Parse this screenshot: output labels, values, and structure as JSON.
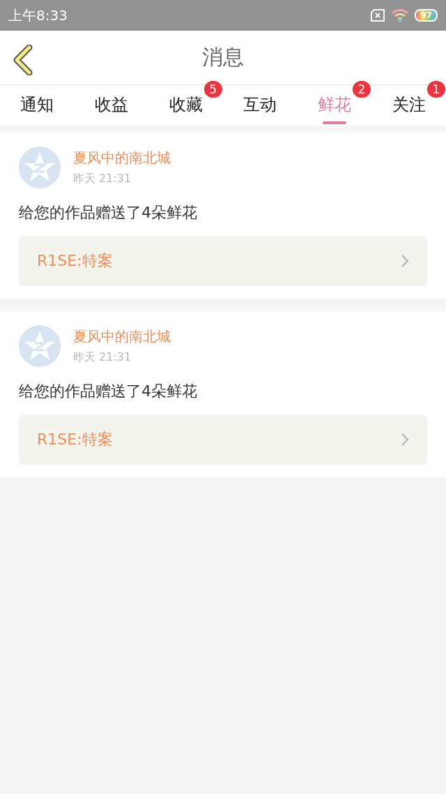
{
  "status_bar": {
    "time": "上午8:33",
    "battery": "97"
  },
  "header": {
    "title": "消息"
  },
  "tabs": [
    {
      "label": "通知",
      "selected": false
    },
    {
      "label": "收益",
      "selected": false
    },
    {
      "label": "收藏",
      "selected": false,
      "badge": "5"
    },
    {
      "label": "互动",
      "selected": false
    },
    {
      "label": "鲜花",
      "selected": true,
      "badge": "2"
    },
    {
      "label": "关注",
      "selected": false,
      "badge": "1"
    }
  ],
  "messages": [
    {
      "user": "夏风中的南北城",
      "time": "昨天 21:31",
      "text": "给您的作品赠送了4朵鲜花",
      "work": "R1SE:特案"
    },
    {
      "user": "夏风中的南北城",
      "time": "昨天 21:31",
      "text": "给您的作品赠送了4朵鲜花",
      "work": "R1SE:特案"
    }
  ]
}
